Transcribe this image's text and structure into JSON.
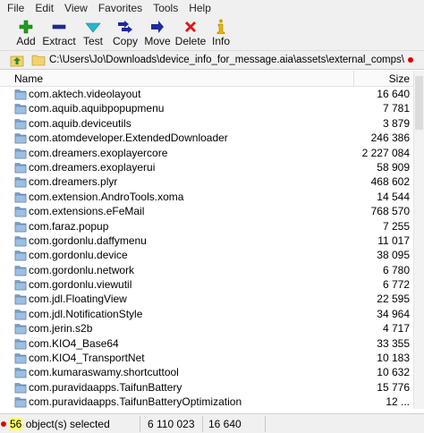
{
  "menu": [
    "File",
    "Edit",
    "View",
    "Favorites",
    "Tools",
    "Help"
  ],
  "toolbar": {
    "add": "Add",
    "extract": "Extract",
    "test": "Test",
    "copy": "Copy",
    "move": "Move",
    "delete": "Delete",
    "info": "Info"
  },
  "address": {
    "path": "C:\\Users\\Jo\\Downloads\\device_info_for_message.aia\\assets\\external_comps\\"
  },
  "columns": {
    "name": "Name",
    "size": "Size"
  },
  "files": [
    {
      "name": "com.aktech.videolayout",
      "size": "16 640"
    },
    {
      "name": "com.aquib.aquibpopupmenu",
      "size": "7 781"
    },
    {
      "name": "com.aquib.deviceutils",
      "size": "3 879"
    },
    {
      "name": "com.atomdeveloper.ExtendedDownloader",
      "size": "246 386"
    },
    {
      "name": "com.dreamers.exoplayercore",
      "size": "2 227 084"
    },
    {
      "name": "com.dreamers.exoplayerui",
      "size": "58 909"
    },
    {
      "name": "com.dreamers.plyr",
      "size": "468 602"
    },
    {
      "name": "com.extension.AndroTools.xoma",
      "size": "14 544"
    },
    {
      "name": "com.extensions.eFeMail",
      "size": "768 570"
    },
    {
      "name": "com.faraz.popup",
      "size": "7 255"
    },
    {
      "name": "com.gordonlu.daffymenu",
      "size": "11 017"
    },
    {
      "name": "com.gordonlu.device",
      "size": "38 095"
    },
    {
      "name": "com.gordonlu.network",
      "size": "6 780"
    },
    {
      "name": "com.gordonlu.viewutil",
      "size": "6 772"
    },
    {
      "name": "com.jdl.FloatingView",
      "size": "22 595"
    },
    {
      "name": "com.jdl.NotificationStyle",
      "size": "34 964"
    },
    {
      "name": "com.jerin.s2b",
      "size": "4 717"
    },
    {
      "name": "com.KIO4_Base64",
      "size": "33 355"
    },
    {
      "name": "com.KIO4_TransportNet",
      "size": "10 183"
    },
    {
      "name": "com.kumaraswamy.shortcuttool",
      "size": "10 632"
    },
    {
      "name": "com.puravidaapps.TaifunBattery",
      "size": "15 776"
    },
    {
      "name": "com.puravidaapps.TaifunBatteryOptimization",
      "size": "12 ..."
    }
  ],
  "status": {
    "count": "56",
    "selected_suffix": " object(s) selected",
    "total_size": "6 110 023",
    "selected_size": "16 640"
  },
  "colors": {
    "add_green": "#1f9d1f",
    "delete_red": "#d81b1b",
    "highlight_yellow": "#ffff66",
    "marker_red": "#e00000"
  }
}
